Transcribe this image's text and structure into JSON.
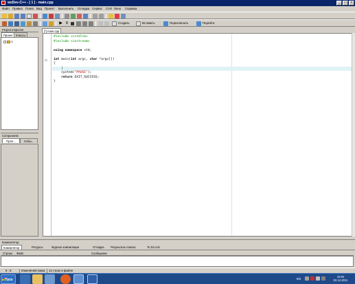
{
  "window": {
    "title": "wxDev-C++ - [ 1 ] - main.cpp",
    "controls": [
      "_",
      "□",
      "×"
    ]
  },
  "menu": [
    "Файл",
    "Правка",
    "Поиск",
    "Вид",
    "Проект",
    "Выполнить",
    "Отладка",
    "Сервис",
    "CVS",
    "Окно",
    "Справка"
  ],
  "toolbar2": {
    "new_label": "Создать",
    "insert_label": "Вставить",
    "toggle_label": "Переключить",
    "goto_label": "Перейти"
  },
  "project_inspector": {
    "title": "Project Inspector",
    "tabs": [
      "Проект",
      "Классы"
    ],
    "tree_root": "1"
  },
  "components": {
    "title": "Components",
    "tabs": [
      "Проп...",
      "Собы..."
    ]
  },
  "editor": {
    "tab_label": "[*] main.cpp",
    "lines": [
      {
        "segments": [
          {
            "t": "#include <cstdlib>",
            "c": "pp"
          }
        ]
      },
      {
        "segments": [
          {
            "t": "#include <iostream>",
            "c": "pp"
          }
        ]
      },
      {
        "segments": []
      },
      {
        "segments": [
          {
            "t": "using namespace",
            "c": "kw"
          },
          {
            "t": " std;",
            "c": ""
          }
        ]
      },
      {
        "segments": []
      },
      {
        "segments": [
          {
            "t": "int",
            "c": "kw"
          },
          {
            "t": " main(",
            "c": ""
          },
          {
            "t": "int",
            "c": "kw"
          },
          {
            "t": " argc, ",
            "c": ""
          },
          {
            "t": "char",
            "c": "kw"
          },
          {
            "t": " *argv[])",
            "c": ""
          }
        ]
      },
      {
        "segments": [
          {
            "t": "{",
            "c": ""
          }
        ]
      },
      {
        "segments": [
          {
            "t": "    |",
            "c": ""
          }
        ]
      },
      {
        "segments": [
          {
            "t": "    system(",
            "c": ""
          },
          {
            "t": "\"PAUSE\"",
            "c": "str"
          },
          {
            "t": ");",
            "c": ""
          }
        ]
      },
      {
        "segments": [
          {
            "t": "    ",
            "c": ""
          },
          {
            "t": "return",
            "c": "kw"
          },
          {
            "t": " EXIT_SUCCESS;",
            "c": ""
          }
        ]
      },
      {
        "segments": [
          {
            "t": "}",
            "c": ""
          }
        ]
      }
    ]
  },
  "compiler": {
    "title": "Компилятор",
    "tabs": [
      "Компилятор",
      "Ресурсы",
      "Журнал компиляции",
      "Отладка",
      "Результаты поиска",
      "To Do List"
    ],
    "columns": [
      "Строка",
      "Файл",
      "Сообщение"
    ]
  },
  "status": {
    "position": "8 : 5",
    "modified": "Изменён",
    "insert_mode": "Вставка",
    "lines_info": "12 строк в файле"
  },
  "taskbar": {
    "start_label": "Пуск",
    "lang": "EN",
    "time": "10:02",
    "date": "02.12.2011"
  }
}
